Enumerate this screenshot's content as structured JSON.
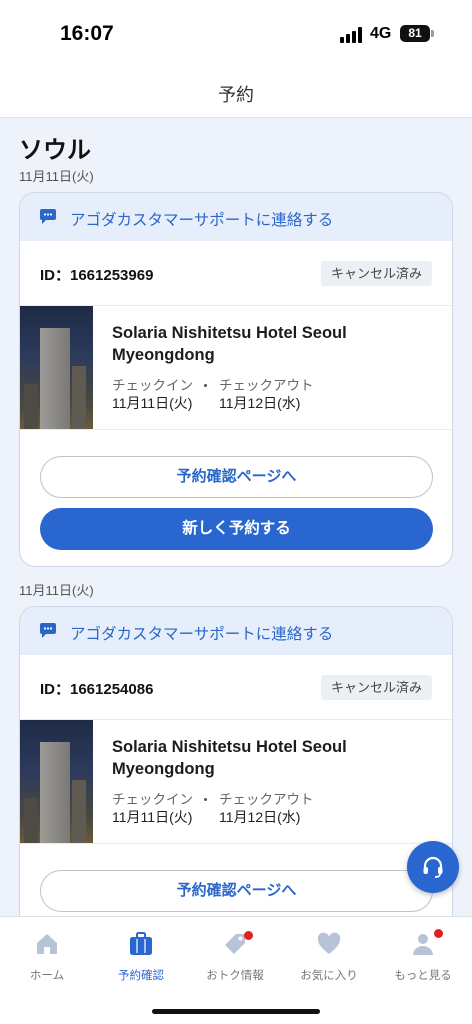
{
  "status": {
    "time": "16:07",
    "network": "4G",
    "battery": "81"
  },
  "nav": {
    "title": "予約"
  },
  "main": {
    "city": "ソウル",
    "bookings": [
      {
        "date": "11月11日(火)",
        "support_text": "アゴダカスタマーサポートに連絡する",
        "id_text": "ID：1661253969",
        "status": "キャンセル済み",
        "hotel_name": "Solaria Nishitetsu Hotel Seoul Myeongdong",
        "checkin_label": "チェックイン",
        "checkin_date": "11月11日(火)",
        "checkout_label": "チェックアウト",
        "checkout_date": "11月12日(水)",
        "confirm_button": "予約確認ページへ",
        "rebook_button": "新しく予約する"
      },
      {
        "date": "11月11日(火)",
        "support_text": "アゴダカスタマーサポートに連絡する",
        "id_text": "ID：1661254086",
        "status": "キャンセル済み",
        "hotel_name": "Solaria Nishitetsu Hotel Seoul Myeongdong",
        "checkin_label": "チェックイン",
        "checkin_date": "11月11日(火)",
        "checkout_label": "チェックアウト",
        "checkout_date": "11月12日(水)",
        "confirm_button": "予約確認ページへ"
      }
    ]
  },
  "tabbar": {
    "items": [
      {
        "label": "ホーム",
        "icon": "home-icon"
      },
      {
        "label": "予約確認",
        "icon": "briefcase-icon",
        "active": true
      },
      {
        "label": "おトク情報",
        "icon": "tag-icon",
        "badge": true
      },
      {
        "label": "お気に入り",
        "icon": "heart-icon"
      },
      {
        "label": "もっと見る",
        "icon": "person-icon",
        "badge": true
      }
    ]
  },
  "colors": {
    "accent": "#2a66cf",
    "support_bg": "#e6eefb",
    "page_bg": "#eef2fa",
    "badge": "#e02020"
  }
}
